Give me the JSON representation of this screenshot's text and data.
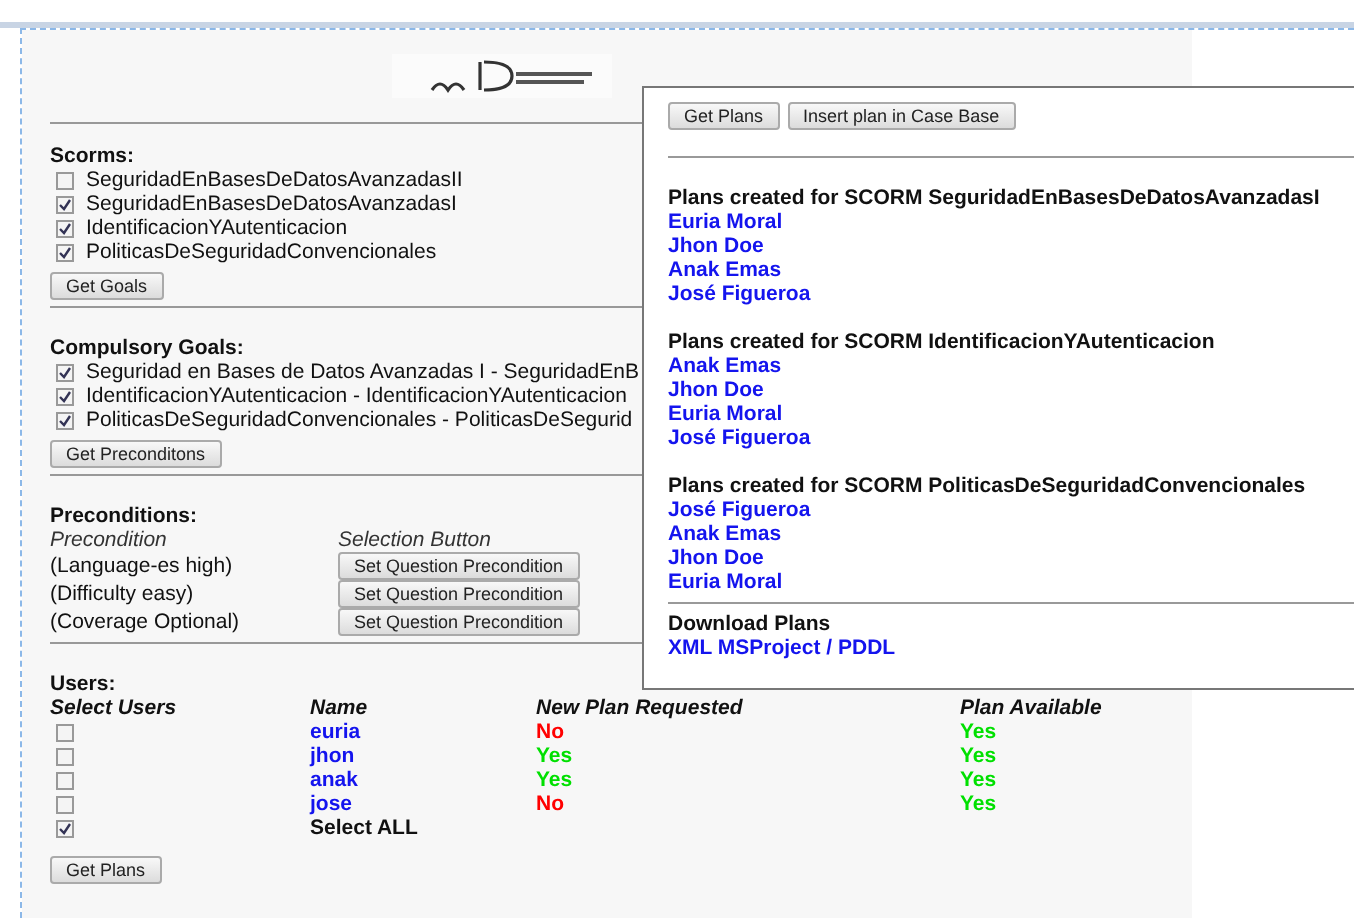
{
  "scorms": {
    "title": "Scorms:",
    "items": [
      {
        "label": "SeguridadEnBasesDeDatosAvanzadasII",
        "checked": false
      },
      {
        "label": "SeguridadEnBasesDeDatosAvanzadasI",
        "checked": true
      },
      {
        "label": "IdentificacionYAutenticacion",
        "checked": true
      },
      {
        "label": "PoliticasDeSeguridadConvencionales",
        "checked": true
      }
    ],
    "button": "Get Goals"
  },
  "goals": {
    "title": "Compulsory Goals:",
    "items": [
      {
        "label": "Seguridad en Bases de Datos Avanzadas I - SeguridadEnB",
        "checked": true
      },
      {
        "label": "IdentificacionYAutenticacion - IdentificacionYAutenticacion",
        "checked": true
      },
      {
        "label": "PoliticasDeSeguridadConvencionales - PoliticasDeSegurid",
        "checked": true
      }
    ],
    "button": "Get Preconditons"
  },
  "preconditions": {
    "title": "Preconditions:",
    "columns": [
      "Precondition",
      "Selection Button"
    ],
    "rows": [
      {
        "precondition": "(Language-es high)",
        "button": "Set Question Precondition"
      },
      {
        "precondition": "(Difficulty easy)",
        "button": "Set Question Precondition"
      },
      {
        "precondition": "(Coverage Optional)",
        "button": "Set Question Precondition"
      }
    ]
  },
  "users": {
    "title": "Users:",
    "columns": [
      "Select Users",
      "Name",
      "New Plan Requested",
      "Plan Available"
    ],
    "rows": [
      {
        "checked": false,
        "name": "euria",
        "requested": {
          "text": "No",
          "color": "#ff0000"
        },
        "available": {
          "text": "Yes",
          "color": "#00e000"
        }
      },
      {
        "checked": false,
        "name": "jhon",
        "requested": {
          "text": "Yes",
          "color": "#00e000"
        },
        "available": {
          "text": "Yes",
          "color": "#00e000"
        }
      },
      {
        "checked": false,
        "name": "anak",
        "requested": {
          "text": "Yes",
          "color": "#00e000"
        },
        "available": {
          "text": "Yes",
          "color": "#00e000"
        }
      },
      {
        "checked": false,
        "name": "jose",
        "requested": {
          "text": "No",
          "color": "#ff0000"
        },
        "available": {
          "text": "Yes",
          "color": "#00e000"
        }
      }
    ],
    "select_all": {
      "checked": true,
      "label": "Select ALL"
    },
    "button": "Get Plans"
  },
  "plans_panel": {
    "buttons": [
      "Get Plans",
      "Insert plan in Case Base"
    ],
    "groups": [
      {
        "title": "Plans created for SCORM SeguridadEnBasesDeDatosAvanzadasI",
        "users": [
          "Euria Moral",
          "Jhon Doe",
          "Anak Emas",
          "José Figueroa"
        ]
      },
      {
        "title": "Plans created for SCORM IdentificacionYAutenticacion",
        "users": [
          "Anak Emas",
          "Jhon Doe",
          "Euria Moral",
          "José Figueroa"
        ]
      },
      {
        "title": "Plans created for SCORM PoliticasDeSeguridadConvencionales",
        "users": [
          "José Figueroa",
          "Anak Emas",
          "Jhon Doe",
          "Euria Moral"
        ]
      }
    ],
    "download": {
      "title": "Download Plans",
      "links": [
        "XML MSProject",
        "PDDL"
      ],
      "separator": "/"
    }
  }
}
